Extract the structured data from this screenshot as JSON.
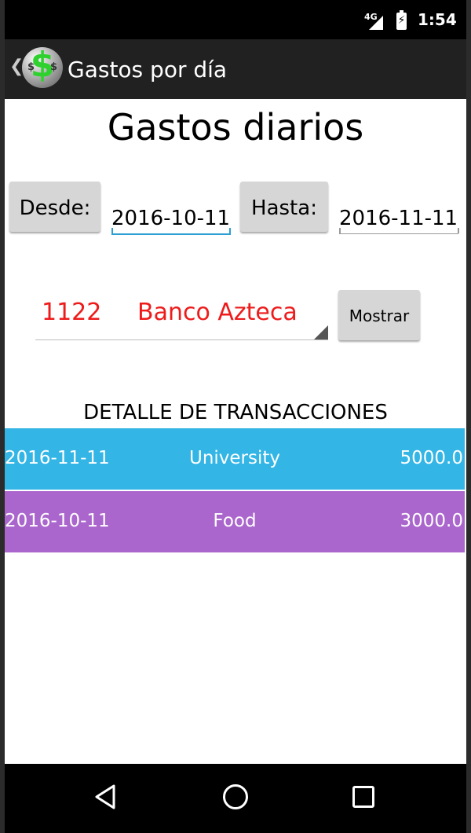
{
  "status_bar": {
    "network": "4G",
    "time": "1:54"
  },
  "action_bar": {
    "title": "Gastos por día",
    "up_glyph": "❮",
    "logo_glyph": "$"
  },
  "header": {
    "title": "Gastos diarios"
  },
  "filters": {
    "desde_label": "Desde:",
    "desde_value": "2016-10-11",
    "hasta_label": "Hasta:",
    "hasta_value": "2016-11-11"
  },
  "account_spinner": {
    "selected_code": "1122",
    "selected_bank": "Banco Azteca",
    "text_color": "#ee1b1b"
  },
  "mostrar_button": {
    "label": "Mostrar"
  },
  "transactions": {
    "title": "DETALLE DE TRANSACCIONES",
    "rows": [
      {
        "date": "2016-11-11",
        "category": "University",
        "amount": "5000.0",
        "color": "#33b5e5"
      },
      {
        "date": "2016-10-11",
        "category": "Food",
        "amount": "3000.0",
        "color": "#aa66cc"
      }
    ]
  },
  "nav_bar": {
    "icons": [
      "back-icon",
      "home-icon",
      "recents-icon"
    ]
  }
}
